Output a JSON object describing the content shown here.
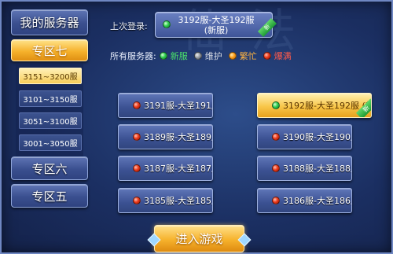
{
  "sidebar": {
    "my_servers": "我的服务器",
    "zones": [
      {
        "label": "专区七",
        "active": true
      },
      {
        "label": "专区六",
        "active": false
      },
      {
        "label": "专区五",
        "active": false
      }
    ],
    "ranges": [
      {
        "label": "3151~3200服",
        "active": true
      },
      {
        "label": "3101~3150服",
        "active": false
      },
      {
        "label": "3051~3100服",
        "active": false
      },
      {
        "label": "3001~3050服",
        "active": false
      }
    ]
  },
  "header": {
    "last_login_label": "上次登录:",
    "last_login_server": "3192服-大圣192服 (新服)",
    "last_login_status": "green",
    "new_badge": "新"
  },
  "legend": {
    "label": "所有服务器:",
    "items": [
      {
        "text": "新服",
        "color": "green"
      },
      {
        "text": "维护",
        "color": "gray"
      },
      {
        "text": "繁忙",
        "color": "orange"
      },
      {
        "text": "爆满",
        "color": "red"
      }
    ]
  },
  "servers": {
    "left": [
      {
        "name": "3191服-大圣191服",
        "status": "red"
      },
      {
        "name": "3189服-大圣189服",
        "status": "red"
      },
      {
        "name": "3187服-大圣187服",
        "status": "red"
      },
      {
        "name": "3185服-大圣185服",
        "status": "red"
      }
    ],
    "right": [
      {
        "name": "3192服-大圣192服 (新",
        "status": "green",
        "highlight": true,
        "badge": "新"
      },
      {
        "name": "3190服-大圣190服",
        "status": "red"
      },
      {
        "name": "3188服-大圣188服",
        "status": "red"
      },
      {
        "name": "3186服-大圣186服",
        "status": "red"
      }
    ]
  },
  "enter_button": "进入游戏",
  "watermark": "仙 法",
  "colors": {
    "accent_gold": "#f6b22c",
    "panel_blue": "#3b5192",
    "status_green": "#2fcf4f",
    "status_gray": "#9aa0a8",
    "status_orange": "#ffa21c",
    "status_red": "#ee3a1c"
  }
}
